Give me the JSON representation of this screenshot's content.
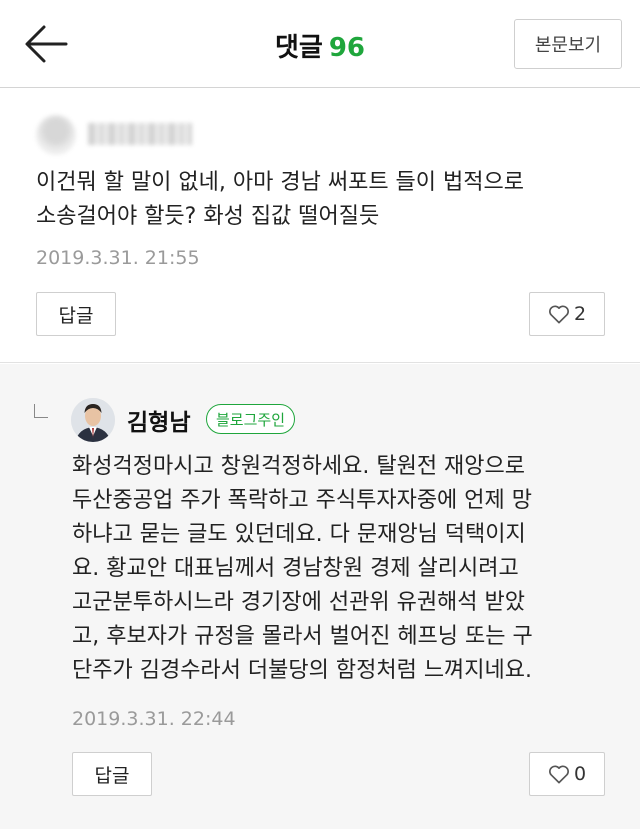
{
  "header": {
    "title": "댓글",
    "count": "96",
    "view_post_label": "본문보기"
  },
  "comments": [
    {
      "text_lines": [
        "이건뭐 할 말이 없네, 아마 경남 써포트 들이 법적으로",
        "소송걸어야 할듯? 화성 집값 떨어질듯"
      ],
      "date": "2019.3.31. 21:55",
      "reply_label": "답글",
      "likes": "2"
    },
    {
      "author": "김형남",
      "badge": "블로그주인",
      "text_lines": [
        "화성걱정마시고 창원걱정하세요. 탈원전 재앙으로",
        "두산중공업 주가 폭락하고 주식투자자중에 언제 망",
        "하냐고 묻는 글도 있던데요. 다 문재앙님 덕택이지",
        "요. 황교안 대표님께서 경남창원 경제 살리시려고",
        "고군분투하시느라 경기장에 선관위 유권해석 받았",
        "고, 후보자가 규정을 몰라서 벌어진 헤프닝 또는 구",
        "단주가 김경수라서 더불당의 함정처럼 느껴지네요."
      ],
      "date": "2019.3.31. 22:44",
      "reply_label": "답글",
      "likes": "0"
    }
  ],
  "colors": {
    "accent": "#1fa63c",
    "reply_bg": "#f6f6f6"
  },
  "icons": {
    "back": "arrow-left-icon",
    "like": "heart-outline-icon",
    "reply_mark": "reply-corner-icon"
  }
}
